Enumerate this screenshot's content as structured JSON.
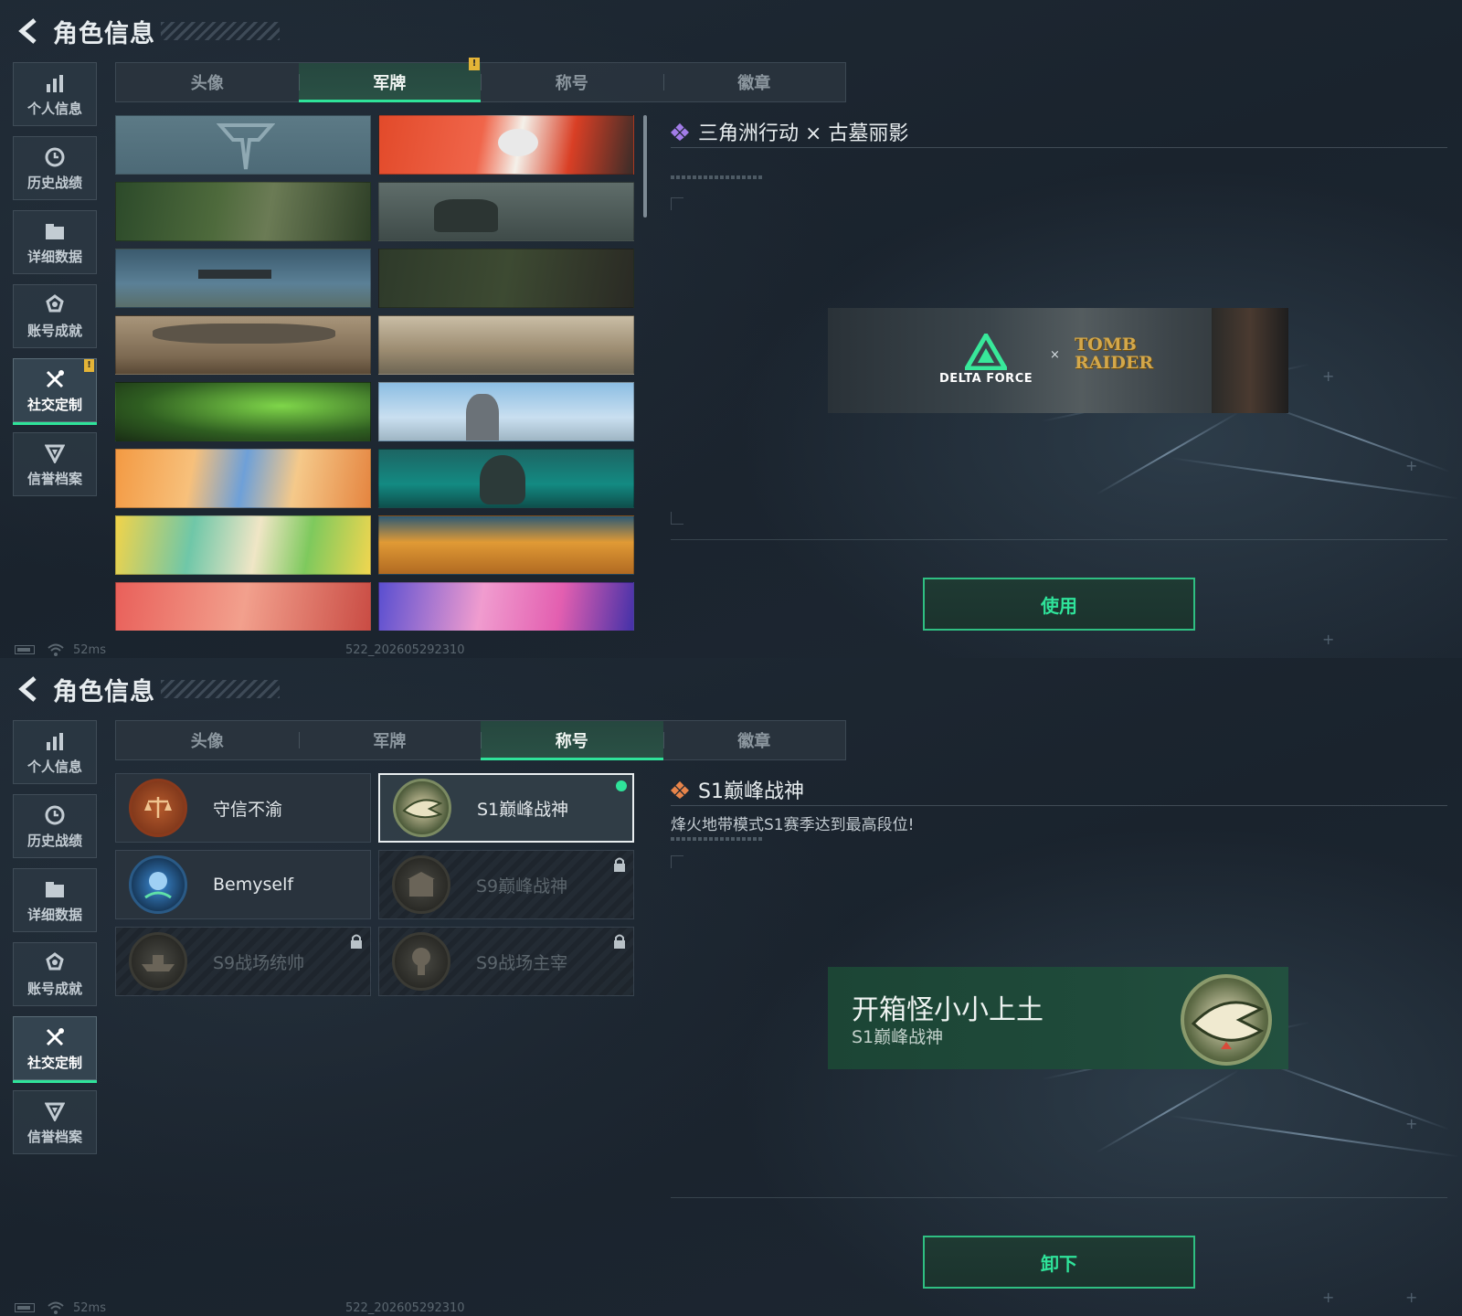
{
  "screens": [
    {
      "header": {
        "title": "角色信息"
      },
      "sidebar": [
        {
          "label": "个人信息",
          "icon": "bar-chart-icon"
        },
        {
          "label": "历史战绩",
          "icon": "history-clock-icon"
        },
        {
          "label": "详细数据",
          "icon": "folder-icon"
        },
        {
          "label": "账号成就",
          "icon": "achievement-icon"
        },
        {
          "label": "社交定制",
          "icon": "tools-icon",
          "active": true,
          "warning": "!"
        },
        {
          "label": "信誉档案",
          "icon": "shield-icon"
        }
      ],
      "tabs": [
        {
          "label": "头像"
        },
        {
          "label": "军牌",
          "active": true,
          "warning": "!"
        },
        {
          "label": "称号"
        },
        {
          "label": "徽章"
        }
      ],
      "detail": {
        "title": "三角洲行动 × 古墓丽影",
        "banner_logo_left": "DELTA FORCE",
        "banner_logo_right_1": "TOMB",
        "banner_logo_right_2": "RAIDER",
        "banner_x": "×",
        "button": "使用"
      },
      "status": {
        "ping": "52ms",
        "build": "522_202605292310"
      }
    },
    {
      "header": {
        "title": "角色信息"
      },
      "sidebar": [
        {
          "label": "个人信息",
          "icon": "bar-chart-icon"
        },
        {
          "label": "历史战绩",
          "icon": "history-clock-icon"
        },
        {
          "label": "详细数据",
          "icon": "folder-icon"
        },
        {
          "label": "账号成就",
          "icon": "achievement-icon"
        },
        {
          "label": "社交定制",
          "icon": "tools-icon",
          "active": true
        },
        {
          "label": "信誉档案",
          "icon": "shield-icon"
        }
      ],
      "tabs": [
        {
          "label": "头像"
        },
        {
          "label": "军牌"
        },
        {
          "label": "称号",
          "active": true
        },
        {
          "label": "徽章"
        }
      ],
      "titles": [
        {
          "name": "守信不渝",
          "locked": false
        },
        {
          "name": "S1巅峰战神",
          "locked": false,
          "selected": true,
          "equipped": true
        },
        {
          "name": "Bemyself",
          "locked": false
        },
        {
          "name": "S9巅峰战神",
          "locked": true
        },
        {
          "name": "S9战场统帅",
          "locked": true
        },
        {
          "name": "S9战场主宰",
          "locked": true
        }
      ],
      "detail": {
        "title": "S1巅峰战神",
        "description": "烽火地带模式S1赛季达到最高段位!",
        "preview_name": "开箱怪小小上土",
        "preview_title": "S1巅峰战神",
        "button": "卸下"
      },
      "status": {
        "ping": "52ms",
        "build": "522_202605292310"
      }
    }
  ],
  "colors": {
    "accent": "#2fe39a",
    "warning": "#e4b437",
    "tab_active_bg": "#2a5145"
  }
}
